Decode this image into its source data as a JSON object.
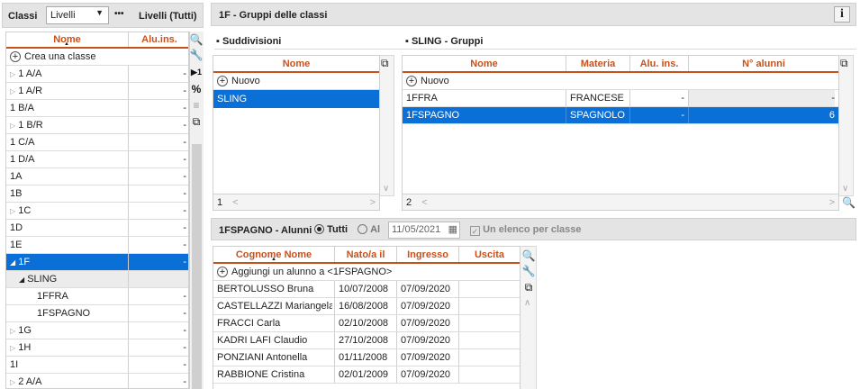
{
  "left": {
    "classi_label": "Classi",
    "select_value": "Livelli",
    "more_label": "•••",
    "title": "Livelli (Tutti)",
    "col_nome": "Nome",
    "col_alu": "Alu.ins.",
    "create_label": "Crea una classe",
    "rows": [
      {
        "name": "1 A/A",
        "val": "-",
        "tri": "▷"
      },
      {
        "name": "1 A/R",
        "val": "-",
        "tri": "▷"
      },
      {
        "name": "1 B/A",
        "val": "-",
        "tri": ""
      },
      {
        "name": "1 B/R",
        "val": "-",
        "tri": "▷"
      },
      {
        "name": "1 C/A",
        "val": "-",
        "tri": ""
      },
      {
        "name": "1 D/A",
        "val": "-",
        "tri": ""
      },
      {
        "name": "1A",
        "val": "-",
        "tri": ""
      },
      {
        "name": "1B",
        "val": "-",
        "tri": ""
      },
      {
        "name": "1C",
        "val": "-",
        "tri": "▷"
      },
      {
        "name": "1D",
        "val": "-",
        "tri": ""
      },
      {
        "name": "1E",
        "val": "-",
        "tri": ""
      },
      {
        "name": "1F",
        "val": "-",
        "tri": "◢"
      },
      {
        "name": "SLING",
        "val": "",
        "tri": "◢"
      },
      {
        "name": "1FFRA",
        "val": "-",
        "tri": ""
      },
      {
        "name": "1FSPAGNO",
        "val": "-",
        "tri": ""
      },
      {
        "name": "1G",
        "val": "-",
        "tri": "▷"
      },
      {
        "name": "1H",
        "val": "-",
        "tri": "▷"
      },
      {
        "name": "1I",
        "val": "-",
        "tri": ""
      },
      {
        "name": "2 A/A",
        "val": "-",
        "tri": "▷"
      }
    ],
    "tools": [
      "🔍",
      "🔧",
      "▶1",
      "%",
      "≡",
      "⧉"
    ]
  },
  "right": {
    "title": "1F - Gruppi delle classi",
    "info_label": "i",
    "suddivisioni_label": "Suddivisioni",
    "sling_label": "SLING - Gruppi",
    "sudd_col": "Nome",
    "sudd_new": "Nuovo",
    "sudd_rows": [
      "SLING"
    ],
    "sudd_page": "1",
    "grp_cols": [
      "Nome",
      "Materia",
      "Alu. ins.",
      "N° alunni"
    ],
    "grp_new": "Nuovo",
    "grp_rows": [
      {
        "nome": "1FFRA",
        "materia": "FRANCESE",
        "alu": "-",
        "num": "-"
      },
      {
        "nome": "1FSPAGNO",
        "materia": "SPAGNOLO",
        "alu": "-",
        "num": "6"
      }
    ],
    "grp_page": "2"
  },
  "students": {
    "title": "1FSPAGNO - Alunni",
    "radio_tutti": "Tutti",
    "radio_al": "Al",
    "date": "11/05/2021",
    "checkbox_label": "Un elenco per classe",
    "cols": [
      "Cognome Nome",
      "Nato/a il",
      "Ingresso",
      "Uscita"
    ],
    "add_label": "Aggiungi un alunno a <1FSPAGNO>",
    "rows": [
      {
        "name": "BERTOLUSSO Bruna",
        "born": "10/07/2008",
        "in": "07/09/2020",
        "out": ""
      },
      {
        "name": "CASTELLAZZI Mariangela",
        "born": "16/08/2008",
        "in": "07/09/2020",
        "out": ""
      },
      {
        "name": "FRACCI Carla",
        "born": "02/10/2008",
        "in": "07/09/2020",
        "out": ""
      },
      {
        "name": "KADRI LAFI Claudio",
        "born": "27/10/2008",
        "in": "07/09/2020",
        "out": ""
      },
      {
        "name": "PONZIANI Antonella",
        "born": "01/11/2008",
        "in": "07/09/2020",
        "out": ""
      },
      {
        "name": "RABBIONE Cristina",
        "born": "02/01/2009",
        "in": "07/09/2020",
        "out": ""
      }
    ]
  }
}
